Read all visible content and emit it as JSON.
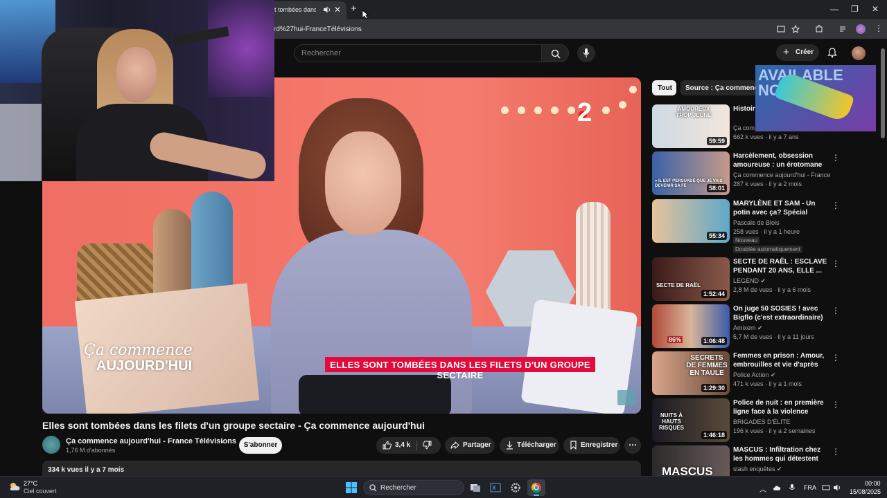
{
  "browser": {
    "tab_title": "Elles sont tombées dans les filets d'un groupe sectaire",
    "tab_title_visible": "t tombées dans les fil",
    "new_tab": "+",
    "close": "✕",
    "url": "rd%27hui-FranceTélévisions",
    "window_controls": [
      "—",
      "❐",
      "✕"
    ]
  },
  "youtube": {
    "search_placeholder": "Rechercher",
    "create_label": "Créer",
    "video": {
      "title": "Elles sont tombées dans les filets d'un groupe sectaire - Ça commence aujourd'hui",
      "overlay_logo_line1": "Ça commence",
      "overlay_logo_line2": "AUJOURD'HUI",
      "overlay_banner": "ELLES SONT TOMBÉES DANS LES FILETS D'UN GROUPE SECTAIRE",
      "channel_number": "2"
    },
    "channel": {
      "name": "Ça commence aujourd'hui - France Télévisions",
      "subscribers": "1,76 M d'abonnés",
      "subscribe_label": "S'abonner"
    },
    "actions": {
      "likes": "3,4 k",
      "share": "Partager",
      "download": "Télécharger",
      "save": "Enregistrer",
      "more": "⋯"
    },
    "description": {
      "views_date": "334 k vues   il y a 7 mois"
    },
    "chips": [
      "Tout",
      "Source : Ça commence a"
    ],
    "recommendations": [
      {
        "title": "Histoire ... rencont",
        "channel": "Ça com",
        "meta": "662 k vues · il y a 7 ans",
        "duration": "59:59",
        "thumb_text": "AMOUREUX TROP JEUNE"
      },
      {
        "title": "Harcèlement, obsession amoureuse : un érotomane leu...",
        "channel": "Ça commence aujourd'hui - France Télévi...",
        "meta": "287 k vues · il y a 2 mois",
        "duration": "58:01",
        "thumb_text": "« IL EST PERSUADÉ QUE JE VAIS DEVENIR SA FE"
      },
      {
        "title": "MARYLÈNE ET SAM - Un potin avec ça? Spécial Osheaga!",
        "channel": "Pascale de Blois",
        "meta": "258 vues · il y a 1 heure",
        "duration": "55:34",
        "badge1": "Nouveau",
        "badge2": "Doublée automatiquement"
      },
      {
        "title": "SECTE DE RAËL : ESCLAVE PENDANT 20 ANS, ELLE ...",
        "channel": "LEGEND ✔",
        "meta": "2,8 M de vues · il y a 6 mois",
        "duration": "1:52:44",
        "thumb_text": "SECTE DE RAËL"
      },
      {
        "title": "On juge 50 SOSIES ! avec Bigflo (c'est extraordinaire) #3",
        "channel": "Amixem ✔",
        "meta": "5,7 M de vues · il y a 11 jours",
        "duration": "1:06:48",
        "thumb_text": "86%"
      },
      {
        "title": "Femmes en prison : Amour, embrouilles et vie d'après",
        "channel": "Police Action ✔",
        "meta": "471 k vues · il y a 1 mois",
        "duration": "1:29:30",
        "thumb_text": "SECRETS DE FEMMES EN TAULE"
      },
      {
        "title": "Police de nuit : en première ligne face à la violence ordinai...",
        "channel": "BRIGADES D'ÉLITE",
        "meta": "196 k vues · il y a 2 semaines",
        "duration": "1:46:18",
        "thumb_text": "NUITS À HAUTS RISQUES"
      },
      {
        "title": "MASCUS : Infiltration chez les hommes qui détestent les ...",
        "channel": "slash enquêtes ✔",
        "meta": "",
        "duration": "",
        "thumb_text": "MASCUS"
      }
    ],
    "ad_text": "AVAILABLE NOW"
  },
  "taskbar": {
    "temp": "27°C",
    "weather": "Ciel couvert",
    "search": "Rechercher",
    "lang": "FRA",
    "time": "00:00",
    "date": "15/08/2025"
  },
  "colors": {
    "accent_red": "#e30a3c",
    "yt_bg": "#0f0f0f",
    "chip_active": "#f1f1f1"
  }
}
